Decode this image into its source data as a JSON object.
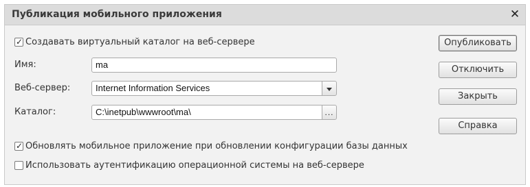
{
  "window": {
    "title": "Публикация мобильного приложения",
    "close_symbol": "✕"
  },
  "options": {
    "create_virtual_catalog": {
      "label": "Создавать виртуальный каталог на веб-сервере",
      "checked": true
    },
    "update_mobile_app": {
      "label": "Обновлять мобильное приложение при обновлении конфигурации базы данных",
      "checked": true
    },
    "use_os_auth": {
      "label": "Использовать аутентификацию операционной системы на веб-сервере",
      "checked": false
    }
  },
  "form": {
    "name": {
      "label": "Имя:",
      "value": "ma"
    },
    "web_server": {
      "label": "Веб-сервер:",
      "value": "Internet Information Services"
    },
    "catalog": {
      "label": "Каталог:",
      "value": "C:\\inetpub\\wwwroot\\ma\\",
      "browse_label": "..."
    }
  },
  "buttons": {
    "publish": "Опубликовать",
    "disable": "Отключить",
    "close": "Закрыть",
    "help": "Справка"
  },
  "icons": {
    "close": "close-icon",
    "dropdown": "chevron-down-icon",
    "checkmark": "checkmark-icon"
  }
}
